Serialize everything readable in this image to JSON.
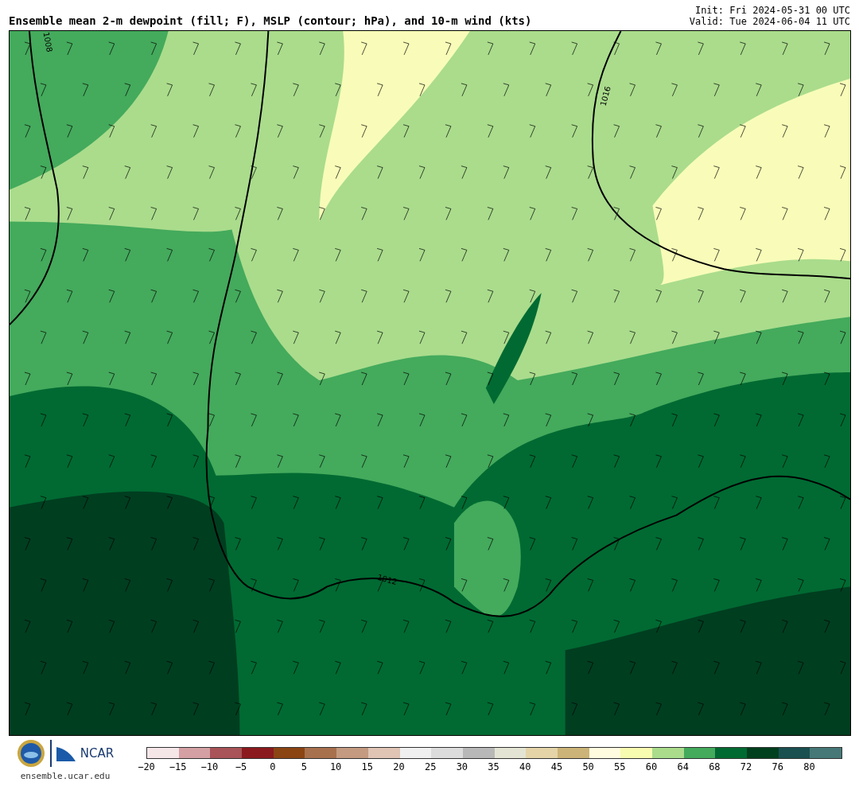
{
  "title": "Ensemble mean 2-m dewpoint (fill; F), MSLP (contour; hPa), and 10-m wind (kts)",
  "init": "Init: Fri 2024-05-31 00 UTC",
  "valid": "Valid: Tue 2024-06-04 11 UTC",
  "map": {
    "contour_labels": [
      "1008",
      "1016",
      "1012"
    ]
  },
  "footer": {
    "logo_text": "NCAR",
    "url": "ensemble.ucar.edu"
  },
  "colorbar": {
    "segments": [
      {
        "label": "−20",
        "color": "#f5e6e8"
      },
      {
        "label": "−15",
        "color": "#d4a0a4"
      },
      {
        "label": "−10",
        "color": "#a85458"
      },
      {
        "label": "−5",
        "color": "#8b1a1e"
      },
      {
        "label": "0",
        "color": "#8b4513"
      },
      {
        "label": "5",
        "color": "#a8714e"
      },
      {
        "label": "10",
        "color": "#c49a80"
      },
      {
        "label": "15",
        "color": "#e0c4b4"
      },
      {
        "label": "20",
        "color": "#f0f0f0"
      },
      {
        "label": "25",
        "color": "#dcdcdc"
      },
      {
        "label": "30",
        "color": "#b8b8b8"
      },
      {
        "label": "35",
        "color": "#e4e4d4"
      },
      {
        "label": "40",
        "color": "#e4d4a8"
      },
      {
        "label": "45",
        "color": "#ccb478"
      },
      {
        "label": "50",
        "color": "#fffce0"
      },
      {
        "label": "55",
        "color": "#f8fcb0"
      },
      {
        "label": "60",
        "color": "#aadc8c"
      },
      {
        "label": "64",
        "color": "#44aa5c"
      },
      {
        "label": "68",
        "color": "#006a32"
      },
      {
        "label": "72",
        "color": "#00401e"
      },
      {
        "label": "76",
        "color": "#1a5050"
      },
      {
        "label": "80",
        "color": "#467878"
      }
    ]
  }
}
